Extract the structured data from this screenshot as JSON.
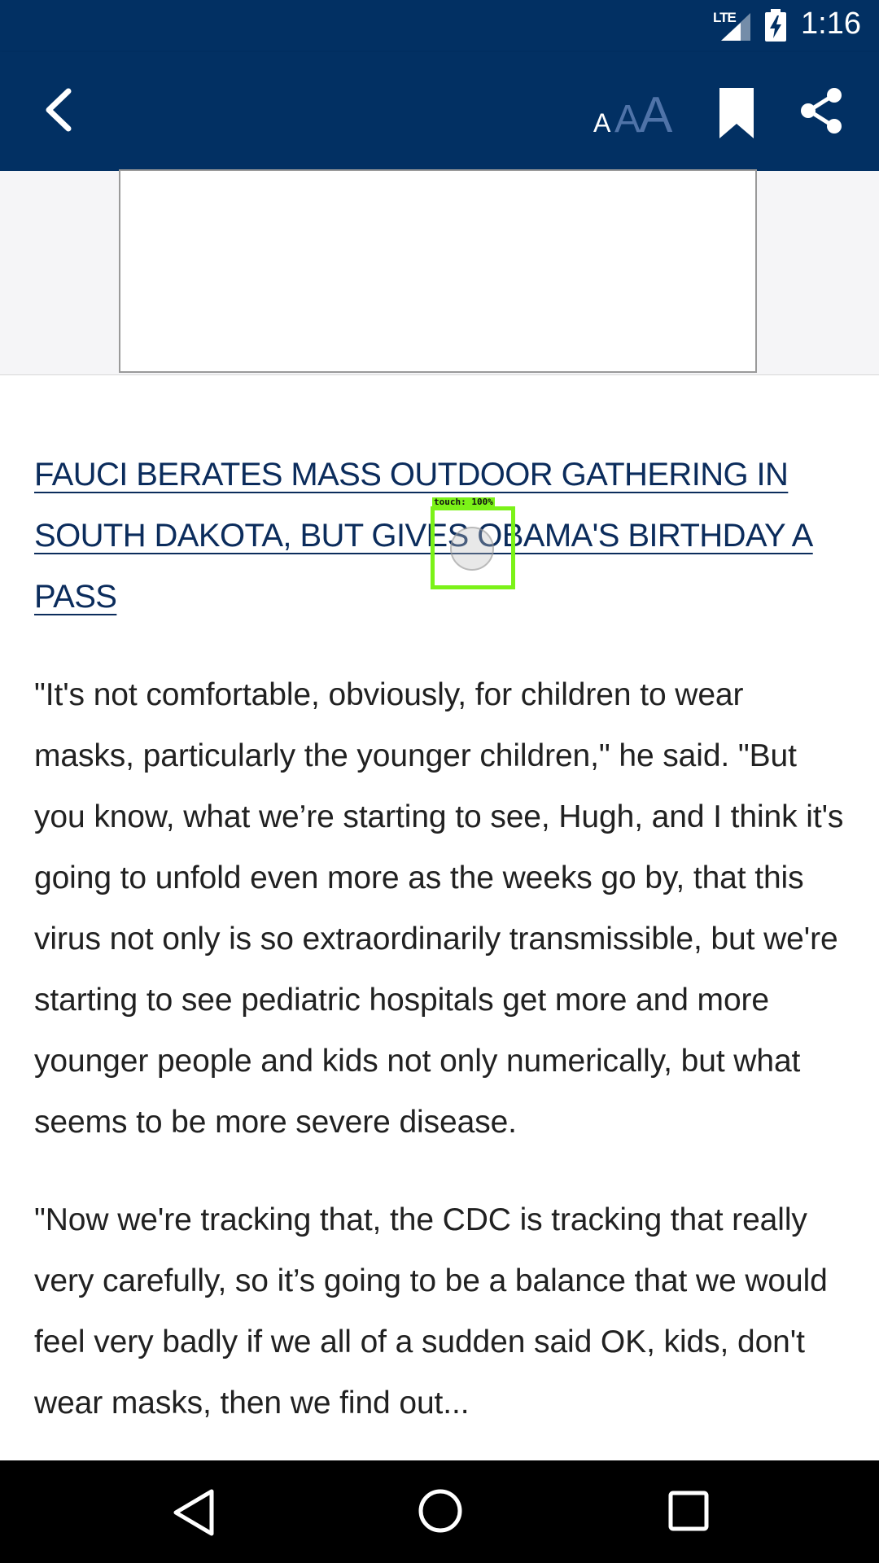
{
  "status_bar": {
    "network": "LTE",
    "time": "1:16",
    "icons": [
      "lte-signal-icon",
      "battery-charging-icon"
    ]
  },
  "app_bar": {
    "icons": [
      "back-arrow-icon",
      "font-size-icon",
      "bookmark-icon",
      "share-icon"
    ],
    "font_size_glyph": "A",
    "background_color": "#023063"
  },
  "ad": {
    "placeholder_content": ""
  },
  "article": {
    "related_link": "FAUCI BERATES MASS OUTDOOR GATHERING IN SOUTH DAKOTA, BUT GIVES OBAMA'S BIRTHDAY A PASS",
    "paragraphs": [
      "\"It's not comfortable, obviously, for children to wear masks, particularly the younger children,\" he said. \"But you know, what we’re starting to see, Hugh, and I think it's going to unfold even more as the weeks go by, that this virus not only is so extraordinarily transmissible, but we're starting to see pediatric hospitals get more and more younger people and kids not only numerically, but what seems to be more severe disease.",
      "\"Now we're tracking that, the CDC is tracking that really very carefully, so it’s going to be a balance that we would feel very badly if we all of a sudden said OK, kids, don't wear masks, then we find out..."
    ],
    "link_color": "#0b2c5c",
    "text_color": "#212121"
  },
  "touch_overlay": {
    "label": "touch: 100%",
    "color": "#7bf218"
  },
  "nav_bar": {
    "icons": [
      "nav-back-icon",
      "nav-home-icon",
      "nav-recents-icon"
    ]
  }
}
